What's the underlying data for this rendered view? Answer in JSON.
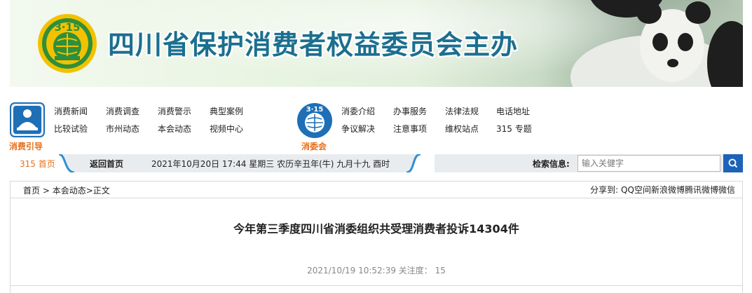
{
  "banner": {
    "title": "四川省保护消费者权益委员会主办",
    "logo_text": "3·15"
  },
  "nav": {
    "left_logo_label": "消费引导",
    "right_logo_label": "消委会",
    "right_logo_text": "3·15",
    "left_links": [
      "消费新闻",
      "消费调查",
      "消费警示",
      "典型案例",
      "比较试验",
      "市州动态",
      "本会动态",
      "视频中心"
    ],
    "right_links": [
      "消委介绍",
      "办事服务",
      "法律法规",
      "电话地址",
      "争议解决",
      "注意事项",
      "维权站点",
      "315 专题"
    ]
  },
  "infobar": {
    "home_315": "315 首页",
    "back_home": "返回首页",
    "datetime": "2021年10月20日 17:44 星期三 农历辛丑年(牛) 九月十九 酉时",
    "search_label": "检索信息:",
    "search_placeholder": "输入关健字"
  },
  "breadcrumb": {
    "home": "首页",
    "sep1": " > ",
    "section": "本会动态",
    "sep2": ">",
    "current": "正文"
  },
  "share": {
    "label": "分享到:",
    "targets": [
      "QQ空间",
      "新浪微博",
      "腾讯微博",
      "微信"
    ]
  },
  "article": {
    "title": "今年第三季度四川省消委组织共受理消费者投诉14304件",
    "meta": "2021/10/19 10:52:39 关注度：  15"
  },
  "colors": {
    "brand_blue": "#1b6f8f",
    "accent_orange": "#e3711e",
    "search_button": "#1d63b8",
    "logo_green": "#2f8f3a",
    "logo_yellow": "#f2c200"
  }
}
